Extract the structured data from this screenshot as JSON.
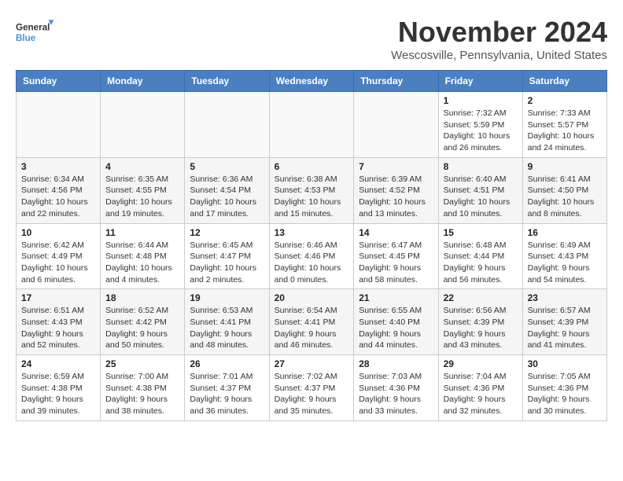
{
  "logo": {
    "line1": "General",
    "line2": "Blue"
  },
  "title": "November 2024",
  "location": "Wescosville, Pennsylvania, United States",
  "days_of_week": [
    "Sunday",
    "Monday",
    "Tuesday",
    "Wednesday",
    "Thursday",
    "Friday",
    "Saturday"
  ],
  "weeks": [
    [
      {
        "day": "",
        "info": ""
      },
      {
        "day": "",
        "info": ""
      },
      {
        "day": "",
        "info": ""
      },
      {
        "day": "",
        "info": ""
      },
      {
        "day": "",
        "info": ""
      },
      {
        "day": "1",
        "info": "Sunrise: 7:32 AM\nSunset: 5:59 PM\nDaylight: 10 hours and 26 minutes."
      },
      {
        "day": "2",
        "info": "Sunrise: 7:33 AM\nSunset: 5:57 PM\nDaylight: 10 hours and 24 minutes."
      }
    ],
    [
      {
        "day": "3",
        "info": "Sunrise: 6:34 AM\nSunset: 4:56 PM\nDaylight: 10 hours and 22 minutes."
      },
      {
        "day": "4",
        "info": "Sunrise: 6:35 AM\nSunset: 4:55 PM\nDaylight: 10 hours and 19 minutes."
      },
      {
        "day": "5",
        "info": "Sunrise: 6:36 AM\nSunset: 4:54 PM\nDaylight: 10 hours and 17 minutes."
      },
      {
        "day": "6",
        "info": "Sunrise: 6:38 AM\nSunset: 4:53 PM\nDaylight: 10 hours and 15 minutes."
      },
      {
        "day": "7",
        "info": "Sunrise: 6:39 AM\nSunset: 4:52 PM\nDaylight: 10 hours and 13 minutes."
      },
      {
        "day": "8",
        "info": "Sunrise: 6:40 AM\nSunset: 4:51 PM\nDaylight: 10 hours and 10 minutes."
      },
      {
        "day": "9",
        "info": "Sunrise: 6:41 AM\nSunset: 4:50 PM\nDaylight: 10 hours and 8 minutes."
      }
    ],
    [
      {
        "day": "10",
        "info": "Sunrise: 6:42 AM\nSunset: 4:49 PM\nDaylight: 10 hours and 6 minutes."
      },
      {
        "day": "11",
        "info": "Sunrise: 6:44 AM\nSunset: 4:48 PM\nDaylight: 10 hours and 4 minutes."
      },
      {
        "day": "12",
        "info": "Sunrise: 6:45 AM\nSunset: 4:47 PM\nDaylight: 10 hours and 2 minutes."
      },
      {
        "day": "13",
        "info": "Sunrise: 6:46 AM\nSunset: 4:46 PM\nDaylight: 10 hours and 0 minutes."
      },
      {
        "day": "14",
        "info": "Sunrise: 6:47 AM\nSunset: 4:45 PM\nDaylight: 9 hours and 58 minutes."
      },
      {
        "day": "15",
        "info": "Sunrise: 6:48 AM\nSunset: 4:44 PM\nDaylight: 9 hours and 56 minutes."
      },
      {
        "day": "16",
        "info": "Sunrise: 6:49 AM\nSunset: 4:43 PM\nDaylight: 9 hours and 54 minutes."
      }
    ],
    [
      {
        "day": "17",
        "info": "Sunrise: 6:51 AM\nSunset: 4:43 PM\nDaylight: 9 hours and 52 minutes."
      },
      {
        "day": "18",
        "info": "Sunrise: 6:52 AM\nSunset: 4:42 PM\nDaylight: 9 hours and 50 minutes."
      },
      {
        "day": "19",
        "info": "Sunrise: 6:53 AM\nSunset: 4:41 PM\nDaylight: 9 hours and 48 minutes."
      },
      {
        "day": "20",
        "info": "Sunrise: 6:54 AM\nSunset: 4:41 PM\nDaylight: 9 hours and 46 minutes."
      },
      {
        "day": "21",
        "info": "Sunrise: 6:55 AM\nSunset: 4:40 PM\nDaylight: 9 hours and 44 minutes."
      },
      {
        "day": "22",
        "info": "Sunrise: 6:56 AM\nSunset: 4:39 PM\nDaylight: 9 hours and 43 minutes."
      },
      {
        "day": "23",
        "info": "Sunrise: 6:57 AM\nSunset: 4:39 PM\nDaylight: 9 hours and 41 minutes."
      }
    ],
    [
      {
        "day": "24",
        "info": "Sunrise: 6:59 AM\nSunset: 4:38 PM\nDaylight: 9 hours and 39 minutes."
      },
      {
        "day": "25",
        "info": "Sunrise: 7:00 AM\nSunset: 4:38 PM\nDaylight: 9 hours and 38 minutes."
      },
      {
        "day": "26",
        "info": "Sunrise: 7:01 AM\nSunset: 4:37 PM\nDaylight: 9 hours and 36 minutes."
      },
      {
        "day": "27",
        "info": "Sunrise: 7:02 AM\nSunset: 4:37 PM\nDaylight: 9 hours and 35 minutes."
      },
      {
        "day": "28",
        "info": "Sunrise: 7:03 AM\nSunset: 4:36 PM\nDaylight: 9 hours and 33 minutes."
      },
      {
        "day": "29",
        "info": "Sunrise: 7:04 AM\nSunset: 4:36 PM\nDaylight: 9 hours and 32 minutes."
      },
      {
        "day": "30",
        "info": "Sunrise: 7:05 AM\nSunset: 4:36 PM\nDaylight: 9 hours and 30 minutes."
      }
    ]
  ]
}
